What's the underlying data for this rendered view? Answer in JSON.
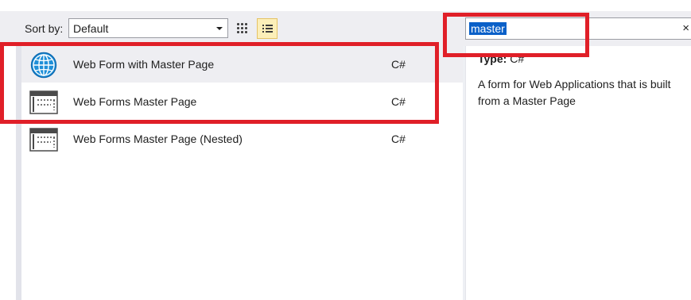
{
  "toolbar": {
    "sort_label": "Sort by:",
    "sort_value": "Default",
    "grid_view_icon": "grid-view-icon",
    "list_view_icon": "list-view-icon"
  },
  "search": {
    "value": "master",
    "clear_icon": "×"
  },
  "templates": [
    {
      "label": "Web Form with Master Page",
      "language": "C#",
      "icon": "globe-icon",
      "selected": true
    },
    {
      "label": "Web Forms Master Page",
      "language": "C#",
      "icon": "master-page-icon",
      "selected": false
    },
    {
      "label": "Web Forms Master Page (Nested)",
      "language": "C#",
      "icon": "master-page-icon",
      "selected": false
    }
  ],
  "details": {
    "type_key": "Type:",
    "type_value": "C#",
    "description_line1": "A form for Web Applications that is built",
    "description_line2": "from a Master Page"
  },
  "colors": {
    "highlight": "#e01f28",
    "selection": "#0a60c8",
    "toolbar_bg": "#eeeef2"
  }
}
